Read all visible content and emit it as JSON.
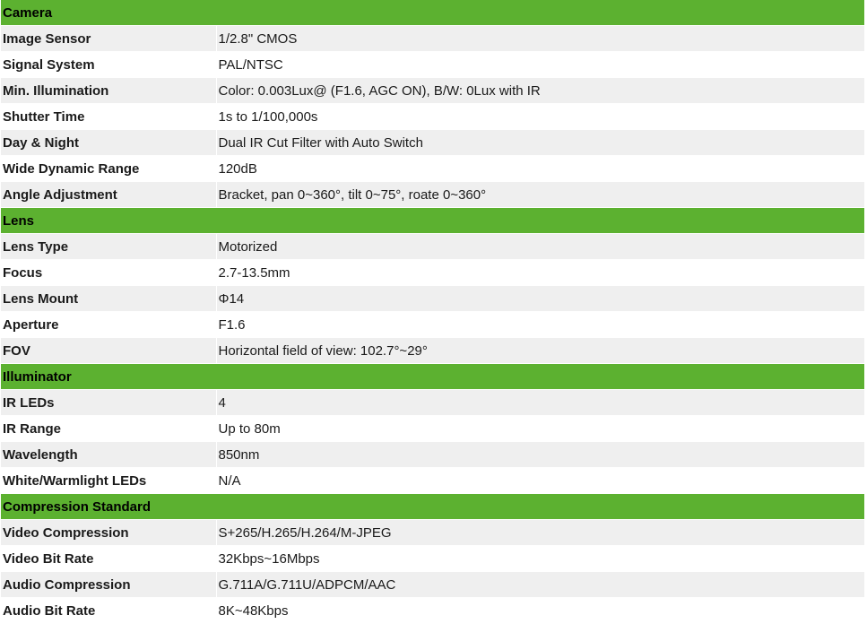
{
  "sections": [
    {
      "title": "Camera",
      "rows": [
        {
          "label": "Image Sensor",
          "value": "1/2.8\" CMOS"
        },
        {
          "label": "Signal System",
          "value": "PAL/NTSC"
        },
        {
          "label": "Min. Illumination",
          "value": "Color: 0.003Lux@ (F1.6, AGC ON), B/W: 0Lux with IR"
        },
        {
          "label": "Shutter Time",
          "value": "1s to 1/100,000s"
        },
        {
          "label": "Day & Night",
          "value": "Dual IR Cut Filter with Auto Switch"
        },
        {
          "label": "Wide Dynamic Range",
          "value": "120dB"
        },
        {
          "label": "Angle Adjustment",
          "value": "Bracket, pan 0~360°, tilt 0~75°, roate 0~360°"
        }
      ]
    },
    {
      "title": "Lens",
      "rows": [
        {
          "label": "Lens Type",
          "value": "Motorized"
        },
        {
          "label": "Focus",
          "value": "2.7-13.5mm"
        },
        {
          "label": "Lens Mount",
          "value": "Φ14"
        },
        {
          "label": "Aperture",
          "value": "F1.6"
        },
        {
          "label": "FOV",
          "value": "Horizontal field of view: 102.7°~29°"
        }
      ]
    },
    {
      "title": "Illuminator",
      "rows": [
        {
          "label": "IR LEDs",
          "value": "4"
        },
        {
          "label": "IR Range",
          "value": "Up to 80m"
        },
        {
          "label": "Wavelength",
          "value": "850nm"
        },
        {
          "label": "White/Warmlight LEDs",
          "value": "N/A"
        }
      ]
    },
    {
      "title": "Compression Standard",
      "rows": [
        {
          "label": "Video Compression",
          "value": "S+265/H.265/H.264/M-JPEG"
        },
        {
          "label": "Video Bit Rate",
          "value": "32Kbps~16Mbps"
        },
        {
          "label": "Audio Compression",
          "value": "G.711A/G.711U/ADPCM/AAC"
        },
        {
          "label": "Audio Bit Rate",
          "value": "8K~48Kbps"
        }
      ]
    }
  ],
  "colors": {
    "section_header": "#5cb130",
    "row_shaded": "#efefef",
    "row_plain": "#ffffff"
  }
}
